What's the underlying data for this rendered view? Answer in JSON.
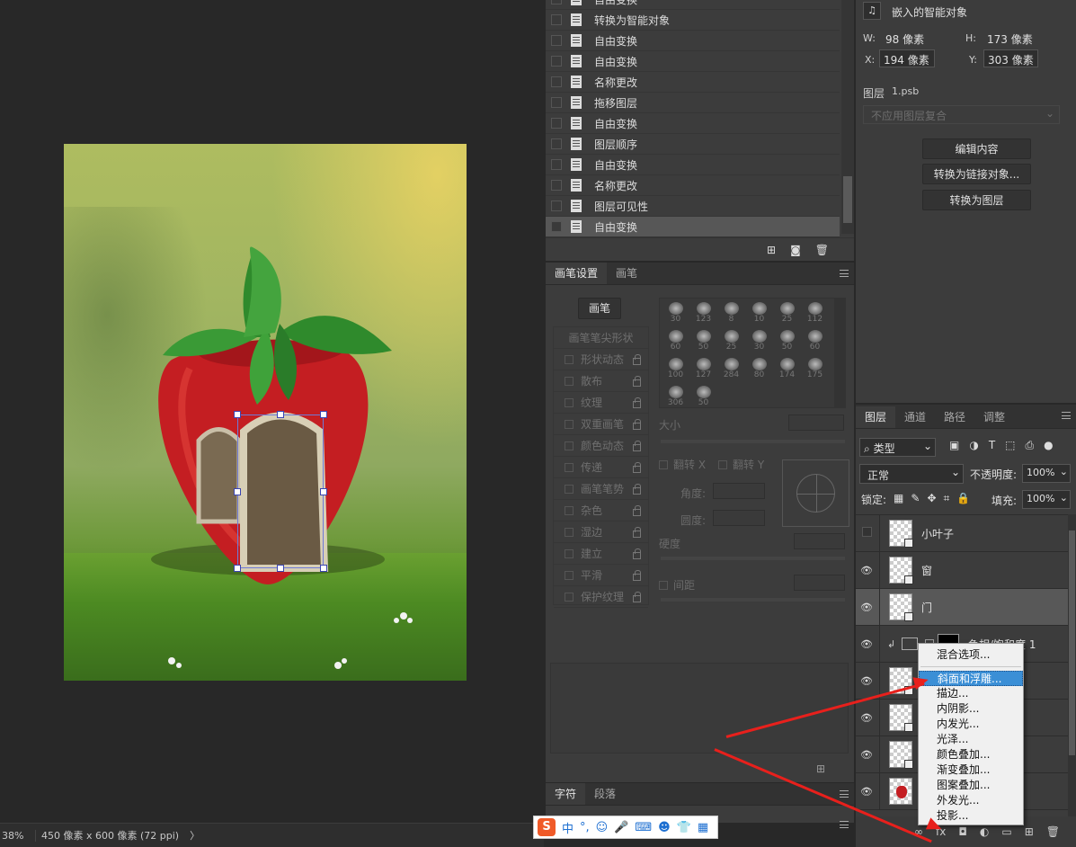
{
  "status": {
    "zoom": "38%",
    "doc_size": "450 像素 x 600 像素 (72 ppi)",
    "arrow": "〉"
  },
  "history": {
    "items": [
      "自由变换",
      "转换为智能对象",
      "自由变换",
      "自由变换",
      "名称更改",
      "拖移图层",
      "自由变换",
      "图层顺序",
      "自由变换",
      "名称更改",
      "图层可见性",
      "自由变换"
    ],
    "selected_index": 11
  },
  "brush": {
    "tabs": [
      "画笔设置",
      "画笔"
    ],
    "brush_button": "画笔",
    "tip_shape": "画笔笔尖形状",
    "options": [
      "形状动态",
      "散布",
      "纹理",
      "双重画笔",
      "颜色动态",
      "传递",
      "画笔笔势",
      "杂色",
      "湿边",
      "建立",
      "平滑",
      "保护纹理"
    ],
    "preset_sizes": [
      "30",
      "123",
      "8",
      "10",
      "25",
      "112",
      "60",
      "50",
      "25",
      "30",
      "50",
      "60",
      "100",
      "127",
      "284",
      "80",
      "174",
      "175",
      "306",
      "50"
    ],
    "size_label": "大小",
    "flip_x": "翻转 X",
    "flip_y": "翻转 Y",
    "angle_label": "角度:",
    "roundness_label": "圆度:",
    "hardness_label": "硬度",
    "spacing_label": "间距"
  },
  "char_tabs": [
    "字符",
    "段落"
  ],
  "props": {
    "title": "嵌入的智能对象",
    "w_label": "W:",
    "w_value": "98 像素",
    "h_label": "H:",
    "h_value": "173 像素",
    "x_label": "X:",
    "x_value": "194 像素",
    "y_label": "Y:",
    "y_value": "303 像素",
    "layer_label": "图层",
    "layer_file": "1.psb",
    "comp_placeholder": "不应用图层复合",
    "buttons": [
      "编辑内容",
      "转换为链接对象...",
      "转换为图层"
    ]
  },
  "layers": {
    "tabs": [
      "图层",
      "通道",
      "路径",
      "调整"
    ],
    "filter": "类型",
    "blend_mode": "正常",
    "opacity_label": "不透明度:",
    "opacity": "100%",
    "lock_label": "锁定:",
    "fill_label": "填充:",
    "fill": "100%",
    "rows": [
      {
        "name": "小叶子",
        "visible": false
      },
      {
        "name": "窗",
        "visible": true
      },
      {
        "name": "门",
        "visible": true,
        "selected": true
      },
      {
        "name": "色相/饱和度 1",
        "visible": true,
        "adjust": true
      },
      {
        "name": "",
        "visible": true
      },
      {
        "name": "",
        "visible": true
      },
      {
        "name": "",
        "visible": true
      },
      {
        "name": "",
        "visible": true
      }
    ]
  },
  "context_menu": {
    "first": "混合选项...",
    "items": [
      "斜面和浮雕...",
      "描边...",
      "内阴影...",
      "内发光...",
      "光泽...",
      "颜色叠加...",
      "渐变叠加...",
      "图案叠加...",
      "外发光...",
      "投影..."
    ],
    "highlighted": 0
  },
  "ime": {
    "lang": "中",
    "punct": "°,"
  },
  "fx_label": "fx"
}
